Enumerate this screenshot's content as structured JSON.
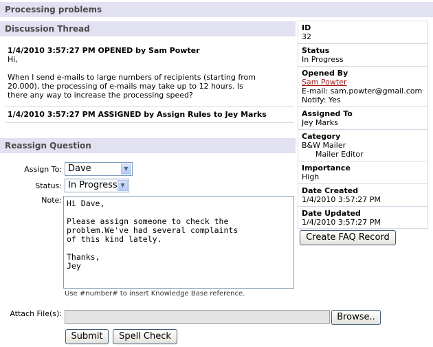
{
  "page_title": "Processing problems",
  "thread": {
    "header": "Discussion Thread",
    "entries": [
      {
        "heading": "1/4/2010 3:57:27 PM OPENED by Sam Powter",
        "greeting": "Hi,",
        "lines": [
          "When I send e-mails to large numbers of recipients (starting from",
          "20.000), the processing of e-mails may take up to 12 hours. Is",
          "there any way to increase the processing speed?"
        ]
      },
      {
        "heading": "1/4/2010 3:57:27 PM ASSIGNED by Assign Rules to Jey Marks"
      }
    ]
  },
  "details": {
    "id_label": "ID",
    "id_value": "32",
    "status_label": "Status",
    "status_value": "In Progress",
    "opened_label": "Opened By",
    "opened_name": "Sam Powter",
    "opened_email": "E-mail: sam.powter@gmail.com",
    "opened_notify": "Notify: Yes",
    "assigned_label": "Assigned To",
    "assigned_value": "Jey Marks",
    "category_label": "Category",
    "category_value": "B&W Mailer",
    "category_sub": "Mailer Editor",
    "importance_label": "Importance",
    "importance_value": "High",
    "created_label": "Date Created",
    "created_value": "1/4/2010 3:57:27 PM",
    "updated_label": "Date Updated",
    "updated_value": "1/4/2010 3:57:27 PM",
    "faq_button": "Create FAQ Record"
  },
  "reassign": {
    "header": "Reassign Question",
    "assign_to_label": "Assign To:",
    "assign_to_value": "Dave",
    "status_label": "Status:",
    "status_value": "In Progress",
    "note_label": "Note:",
    "note_value": "Hi Dave,\n\nPlease assign someone to check the\nproblem.We've had several complaints\nof this kind lately.\n\nThanks,\nJey",
    "note_hint": "Use #number# to insert Knowledge Base reference.",
    "attach_label": "Attach File(s):",
    "browse_button": "Browse..",
    "submit_button": "Submit",
    "spell_button": "Spell Check"
  }
}
